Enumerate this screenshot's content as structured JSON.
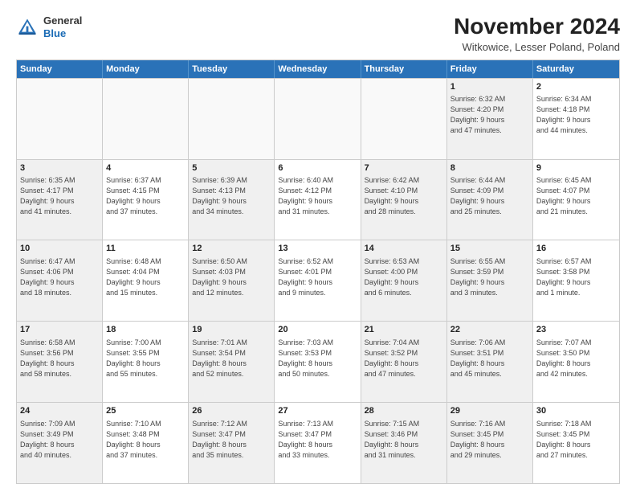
{
  "logo": {
    "general": "General",
    "blue": "Blue"
  },
  "header": {
    "month": "November 2024",
    "location": "Witkowice, Lesser Poland, Poland"
  },
  "weekdays": [
    "Sunday",
    "Monday",
    "Tuesday",
    "Wednesday",
    "Thursday",
    "Friday",
    "Saturday"
  ],
  "weeks": [
    [
      {
        "day": "",
        "info": "",
        "empty": true
      },
      {
        "day": "",
        "info": "",
        "empty": true
      },
      {
        "day": "",
        "info": "",
        "empty": true
      },
      {
        "day": "",
        "info": "",
        "empty": true
      },
      {
        "day": "",
        "info": "",
        "empty": true
      },
      {
        "day": "1",
        "info": "Sunrise: 6:32 AM\nSunset: 4:20 PM\nDaylight: 9 hours\nand 47 minutes.",
        "shaded": true
      },
      {
        "day": "2",
        "info": "Sunrise: 6:34 AM\nSunset: 4:18 PM\nDaylight: 9 hours\nand 44 minutes."
      }
    ],
    [
      {
        "day": "3",
        "info": "Sunrise: 6:35 AM\nSunset: 4:17 PM\nDaylight: 9 hours\nand 41 minutes.",
        "shaded": true
      },
      {
        "day": "4",
        "info": "Sunrise: 6:37 AM\nSunset: 4:15 PM\nDaylight: 9 hours\nand 37 minutes."
      },
      {
        "day": "5",
        "info": "Sunrise: 6:39 AM\nSunset: 4:13 PM\nDaylight: 9 hours\nand 34 minutes.",
        "shaded": true
      },
      {
        "day": "6",
        "info": "Sunrise: 6:40 AM\nSunset: 4:12 PM\nDaylight: 9 hours\nand 31 minutes."
      },
      {
        "day": "7",
        "info": "Sunrise: 6:42 AM\nSunset: 4:10 PM\nDaylight: 9 hours\nand 28 minutes.",
        "shaded": true
      },
      {
        "day": "8",
        "info": "Sunrise: 6:44 AM\nSunset: 4:09 PM\nDaylight: 9 hours\nand 25 minutes.",
        "shaded": true
      },
      {
        "day": "9",
        "info": "Sunrise: 6:45 AM\nSunset: 4:07 PM\nDaylight: 9 hours\nand 21 minutes."
      }
    ],
    [
      {
        "day": "10",
        "info": "Sunrise: 6:47 AM\nSunset: 4:06 PM\nDaylight: 9 hours\nand 18 minutes.",
        "shaded": true
      },
      {
        "day": "11",
        "info": "Sunrise: 6:48 AM\nSunset: 4:04 PM\nDaylight: 9 hours\nand 15 minutes."
      },
      {
        "day": "12",
        "info": "Sunrise: 6:50 AM\nSunset: 4:03 PM\nDaylight: 9 hours\nand 12 minutes.",
        "shaded": true
      },
      {
        "day": "13",
        "info": "Sunrise: 6:52 AM\nSunset: 4:01 PM\nDaylight: 9 hours\nand 9 minutes."
      },
      {
        "day": "14",
        "info": "Sunrise: 6:53 AM\nSunset: 4:00 PM\nDaylight: 9 hours\nand 6 minutes.",
        "shaded": true
      },
      {
        "day": "15",
        "info": "Sunrise: 6:55 AM\nSunset: 3:59 PM\nDaylight: 9 hours\nand 3 minutes.",
        "shaded": true
      },
      {
        "day": "16",
        "info": "Sunrise: 6:57 AM\nSunset: 3:58 PM\nDaylight: 9 hours\nand 1 minute."
      }
    ],
    [
      {
        "day": "17",
        "info": "Sunrise: 6:58 AM\nSunset: 3:56 PM\nDaylight: 8 hours\nand 58 minutes.",
        "shaded": true
      },
      {
        "day": "18",
        "info": "Sunrise: 7:00 AM\nSunset: 3:55 PM\nDaylight: 8 hours\nand 55 minutes."
      },
      {
        "day": "19",
        "info": "Sunrise: 7:01 AM\nSunset: 3:54 PM\nDaylight: 8 hours\nand 52 minutes.",
        "shaded": true
      },
      {
        "day": "20",
        "info": "Sunrise: 7:03 AM\nSunset: 3:53 PM\nDaylight: 8 hours\nand 50 minutes."
      },
      {
        "day": "21",
        "info": "Sunrise: 7:04 AM\nSunset: 3:52 PM\nDaylight: 8 hours\nand 47 minutes.",
        "shaded": true
      },
      {
        "day": "22",
        "info": "Sunrise: 7:06 AM\nSunset: 3:51 PM\nDaylight: 8 hours\nand 45 minutes.",
        "shaded": true
      },
      {
        "day": "23",
        "info": "Sunrise: 7:07 AM\nSunset: 3:50 PM\nDaylight: 8 hours\nand 42 minutes."
      }
    ],
    [
      {
        "day": "24",
        "info": "Sunrise: 7:09 AM\nSunset: 3:49 PM\nDaylight: 8 hours\nand 40 minutes.",
        "shaded": true
      },
      {
        "day": "25",
        "info": "Sunrise: 7:10 AM\nSunset: 3:48 PM\nDaylight: 8 hours\nand 37 minutes."
      },
      {
        "day": "26",
        "info": "Sunrise: 7:12 AM\nSunset: 3:47 PM\nDaylight: 8 hours\nand 35 minutes.",
        "shaded": true
      },
      {
        "day": "27",
        "info": "Sunrise: 7:13 AM\nSunset: 3:47 PM\nDaylight: 8 hours\nand 33 minutes."
      },
      {
        "day": "28",
        "info": "Sunrise: 7:15 AM\nSunset: 3:46 PM\nDaylight: 8 hours\nand 31 minutes.",
        "shaded": true
      },
      {
        "day": "29",
        "info": "Sunrise: 7:16 AM\nSunset: 3:45 PM\nDaylight: 8 hours\nand 29 minutes.",
        "shaded": true
      },
      {
        "day": "30",
        "info": "Sunrise: 7:18 AM\nSunset: 3:45 PM\nDaylight: 8 hours\nand 27 minutes."
      }
    ]
  ]
}
